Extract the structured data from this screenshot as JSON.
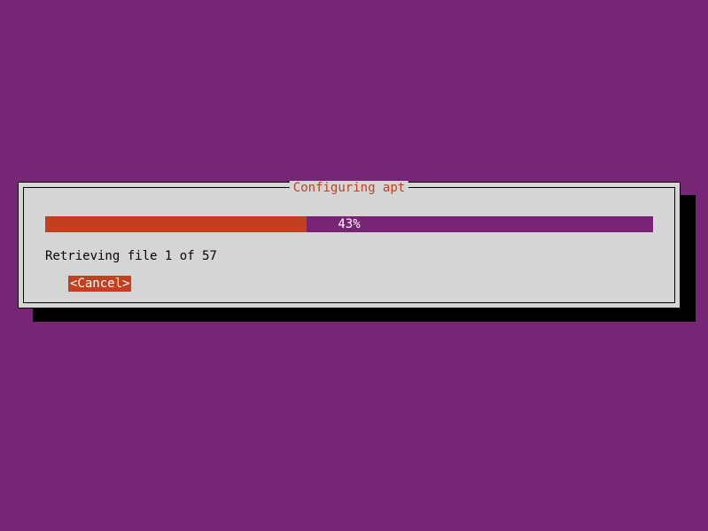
{
  "dialog": {
    "title": "Configuring apt",
    "progress": {
      "percent": 43,
      "percent_label": "43%",
      "fill_width": "43%"
    },
    "status": "Retrieving file 1 of 57",
    "cancel_button": "<Cancel>"
  }
}
